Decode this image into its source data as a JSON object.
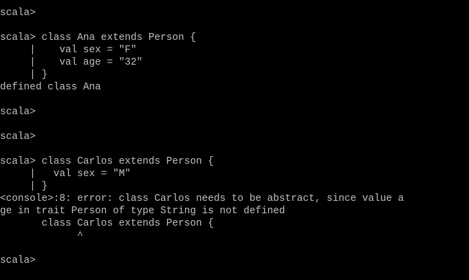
{
  "terminal": {
    "lines": [
      "scala>",
      "",
      "scala> class Ana extends Person {",
      "     |    val sex = \"F\"",
      "     |    val age = \"32\"",
      "     | }",
      "defined class Ana",
      "",
      "scala>",
      "",
      "scala>",
      "",
      "scala> class Carlos extends Person {",
      "     |   val sex = \"M\"",
      "     | }",
      "<console>:8: error: class Carlos needs to be abstract, since value a",
      "ge in trait Person of type String is not defined",
      "       class Carlos extends Person {",
      "             ^",
      "",
      "scala>"
    ]
  },
  "colors": {
    "background": "#000000",
    "text": "#c0c0c0"
  }
}
